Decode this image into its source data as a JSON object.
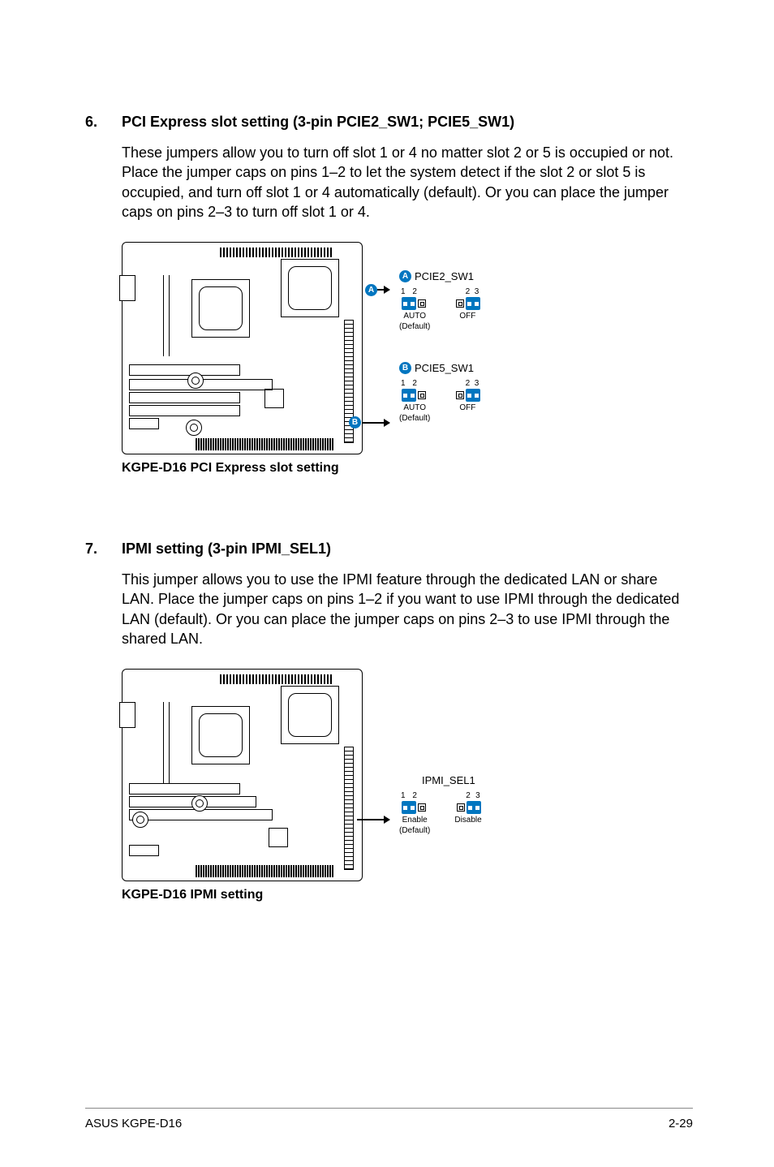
{
  "section6": {
    "number": "6.",
    "heading": "PCI Express slot setting (3-pin PCIE2_SW1; PCIE5_SW1)",
    "body": "These jumpers allow you to turn off slot 1 or 4 no matter slot 2 or 5 is occupied or not. Place the jumper caps on pins 1–2 to let the system detect if the slot 2 or slot 5 is occupied, and turn off slot 1 or 4 automatically (default). Or you can place the jumper caps on pins 2–3 to turn off slot 1 or 4.",
    "caption": "KGPE-D16 PCI Express slot setting",
    "markerA": "A",
    "markerB": "B",
    "legendA": {
      "title": "PCIE2_SW1",
      "left_pins": {
        "a": "1",
        "b": "2"
      },
      "right_pins": {
        "a": "2",
        "b": "3"
      },
      "left_label1": "AUTO",
      "left_label2": "(Default)",
      "right_label": "OFF"
    },
    "legendB": {
      "title": "PCIE5_SW1",
      "left_pins": {
        "a": "1",
        "b": "2"
      },
      "right_pins": {
        "a": "2",
        "b": "3"
      },
      "left_label1": "AUTO",
      "left_label2": "(Default)",
      "right_label": "OFF"
    }
  },
  "section7": {
    "number": "7.",
    "heading": "IPMI setting (3-pin IPMI_SEL1)",
    "body": "This jumper allows you to use the IPMI feature through the dedicated LAN or share LAN. Place the jumper caps on pins 1–2 if you want to use IPMI through the dedicated LAN (default). Or you can place the jumper caps on pins 2–3 to use IPMI through the shared LAN.",
    "caption": "KGPE-D16 IPMI setting",
    "legend": {
      "title": "IPMI_SEL1",
      "left_pins": {
        "a": "1",
        "b": "2"
      },
      "right_pins": {
        "a": "2",
        "b": "3"
      },
      "left_label1": "Enable",
      "left_label2": "(Default)",
      "right_label": "Disable"
    }
  },
  "footer": {
    "left": "ASUS KGPE-D16",
    "right": "2-29"
  }
}
